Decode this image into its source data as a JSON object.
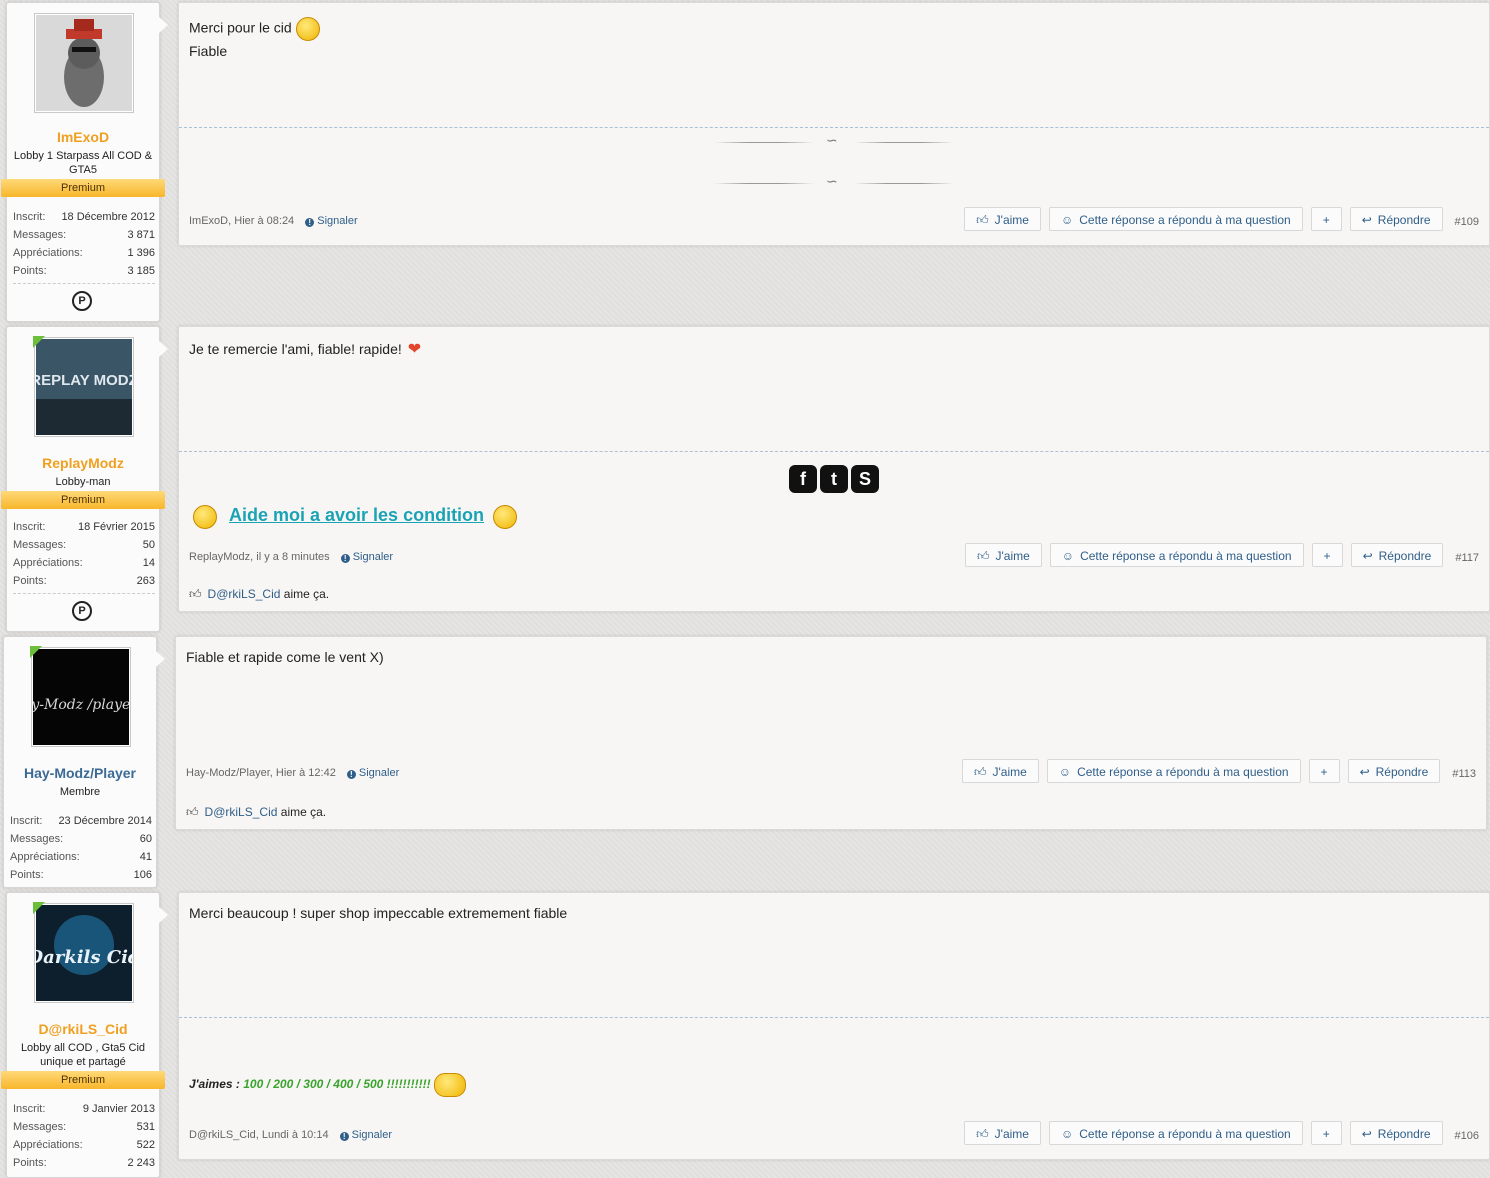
{
  "posts": [
    {
      "user": {
        "name": "ImExoD",
        "name_color": "#f0a020",
        "title": "Lobby 1 Starpass All COD & GTA5",
        "ribbon": "Premium",
        "online": false,
        "stats": {
          "inscrit_label": "Inscrit:",
          "inscrit": "18 Décembre 2012",
          "messages_label": "Messages:",
          "messages": "3 871",
          "appreciations_label": "Appréciations:",
          "appreciations": "1 396",
          "points_label": "Points:",
          "points": "3 185"
        }
      },
      "text_lines": [
        "Merci pour le cid",
        "Fiable"
      ],
      "meta": {
        "author": "ImExoD",
        "time": "Hier à 08:24",
        "report": "Signaler"
      },
      "number": "#109"
    },
    {
      "user": {
        "name": "ReplayModz",
        "name_color": "#f0a020",
        "title": "Lobby-man",
        "ribbon": "Premium",
        "online": true,
        "stats": {
          "inscrit_label": "Inscrit:",
          "inscrit": "18 Février 2015",
          "messages_label": "Messages:",
          "messages": "50",
          "appreciations_label": "Appréciations:",
          "appreciations": "14",
          "points_label": "Points:",
          "points": "263"
        }
      },
      "text_lines": [
        "Je te remercie l'ami, fiable! rapide!"
      ],
      "signature_link": "Aide moi a avoir les condition",
      "meta": {
        "author": "ReplayModz",
        "time": "il y a 8 minutes",
        "report": "Signaler"
      },
      "number": "#117",
      "likes": {
        "user": "D@rkiLS_Cid",
        "suffix": "aime ça."
      }
    },
    {
      "user": {
        "name": "Hay-Modz/Player",
        "name_color": "#3b6a94",
        "title": "Membre",
        "online": true,
        "stats": {
          "inscrit_label": "Inscrit:",
          "inscrit": "23 Décembre 2014",
          "messages_label": "Messages:",
          "messages": "60",
          "appreciations_label": "Appréciations:",
          "appreciations": "41",
          "points_label": "Points:",
          "points": "106"
        }
      },
      "text_lines": [
        "Fiable et rapide come le vent X)"
      ],
      "meta": {
        "author": "Hay-Modz/Player",
        "time": "Hier à 12:42",
        "report": "Signaler"
      },
      "number": "#113",
      "likes": {
        "user": "D@rkiLS_Cid",
        "suffix": "aime ça."
      }
    },
    {
      "user": {
        "name": "D@rkiLS_Cid",
        "name_color": "#f0a020",
        "title": "Lobby all COD , Gta5 Cid unique et partagé",
        "ribbon": "Premium",
        "online": true,
        "stats": {
          "inscrit_label": "Inscrit:",
          "inscrit": "9 Janvier 2013",
          "messages_label": "Messages:",
          "messages": "531",
          "appreciations_label": "Appréciations:",
          "appreciations": "522",
          "points_label": "Points:",
          "points": "2 243"
        }
      },
      "text_lines": [
        "Merci beaucoup ! super shop impeccable extremement fiable"
      ],
      "signature": {
        "prefix": "J'aimes :",
        "values": "100 / 200 / 300 / 400 / 500 !!!!!!!!!!!"
      },
      "meta": {
        "author": "D@rkiLS_Cid",
        "time": "Lundi à 10:14",
        "report": "Signaler"
      },
      "number": "#106"
    }
  ],
  "actions": {
    "like": "J'aime",
    "answered": "Cette réponse a répondu à ma question",
    "plus": "+",
    "reply": "Répondre"
  },
  "avatar_text": {
    "replay": "REPLAY MODZ",
    "hay": "Hay-Modz /player`s",
    "dark": "Darkils Cid"
  },
  "icons": {
    "like": "thumbs-up-icon",
    "answered": "smiley-icon",
    "reply": "reply-arrow-icon",
    "report": "info-icon",
    "platform": "playstation-icon"
  }
}
